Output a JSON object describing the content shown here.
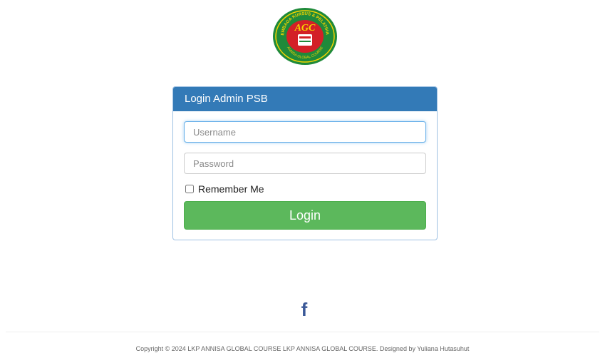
{
  "logo": {
    "text": "AGC",
    "arc_top": "LEMBAGA KURSUS & PELATIHAN",
    "arc_bottom": "ANNISA GLOBAL COURSE",
    "colors": {
      "ring": "#1f8a3a",
      "inner": "#d32027",
      "text": "#f5d400"
    }
  },
  "panel": {
    "title": "Login Admin PSB",
    "username_placeholder": "Username",
    "password_placeholder": "Password",
    "remember_label": "Remember Me",
    "remember_checked": false,
    "login_label": "Login"
  },
  "footer": {
    "facebook_icon": "f",
    "copyright": "Copyright © 2024 LKP ANNISA GLOBAL COURSE LKP ANNISA GLOBAL COURSE. Designed by Yuliana Hutasuhut"
  },
  "colors": {
    "heading_bg": "#337ab7",
    "button_bg": "#5cb85c",
    "facebook": "#3b5998"
  }
}
